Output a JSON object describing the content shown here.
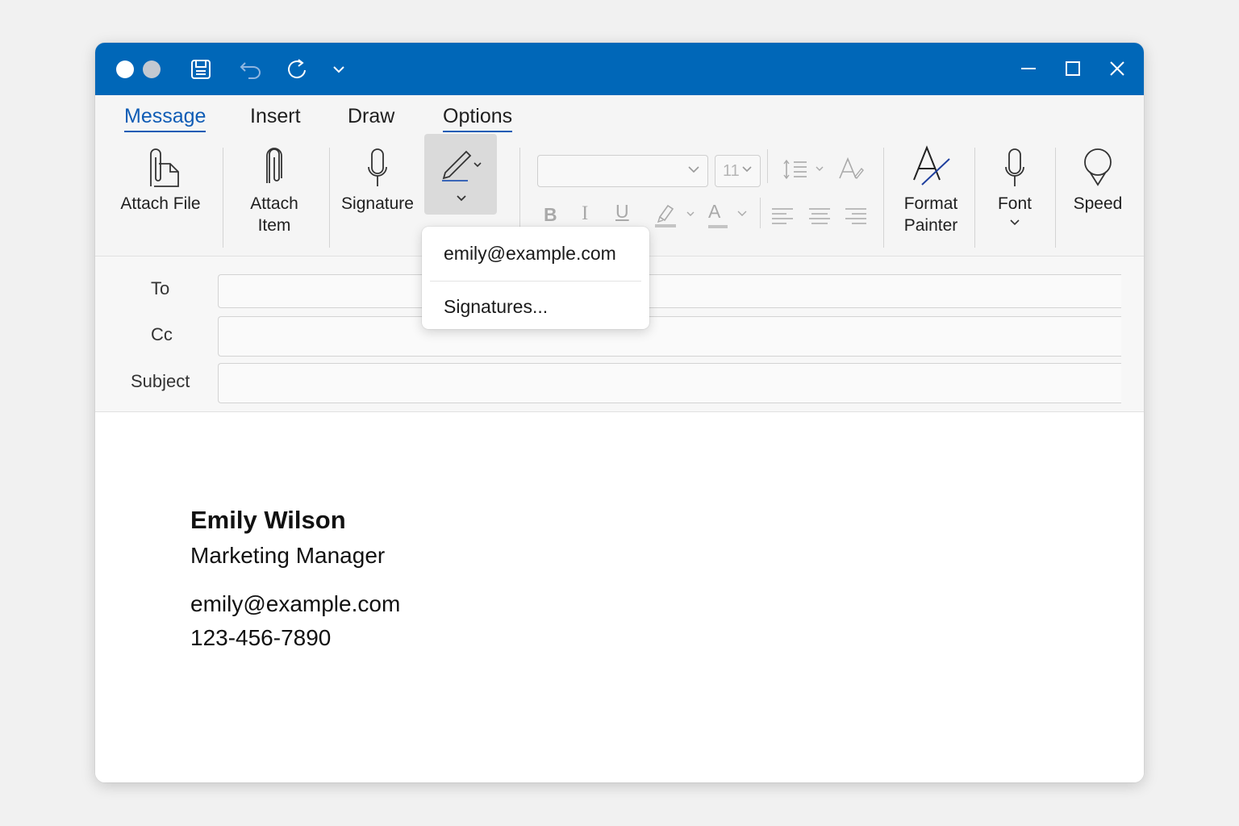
{
  "titlebar": {
    "controls": [
      "save-icon",
      "undo-icon",
      "redo-icon",
      "customize-chevron-icon"
    ],
    "window_controls": [
      "minimize-icon",
      "maximize-icon",
      "close-icon"
    ],
    "accent": "#0067b8"
  },
  "tabs": [
    {
      "label": "Message",
      "active": true
    },
    {
      "label": "Insert"
    },
    {
      "label": "Draw"
    },
    {
      "label": "Options"
    }
  ],
  "ribbon": {
    "attach_file": "Attach File",
    "attach_item_line1": "Attach",
    "attach_item_line2": "Item",
    "signature": "Signature",
    "font_size": "11",
    "bold": "B",
    "italic": "I",
    "underline": "U",
    "font_color": "A",
    "format_painter_line1": "Format",
    "format_painter_line2": "Painter",
    "font": "Font",
    "speed": "Speed"
  },
  "fields": {
    "to_label": "To",
    "cc_label": "Cc",
    "subject_label": "Subject",
    "to_value": "",
    "cc_value": "",
    "subject_value": ""
  },
  "body": {
    "name": "Emily Wilson",
    "title": "Marketing Manager",
    "email": "emily@example.com",
    "phone": "123-456-7890"
  },
  "signature_menu": {
    "items": [
      "emily@example.com",
      "Signatures..."
    ]
  }
}
